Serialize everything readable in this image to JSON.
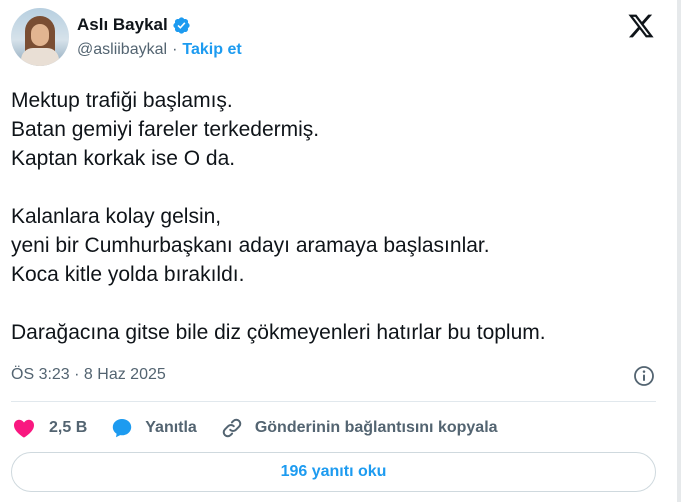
{
  "author": {
    "name": "Aslı Baykal",
    "handle": "@asliibaykal",
    "separator": "·",
    "follow_label": "Takip et"
  },
  "icons": {
    "verified": "verified-badge-icon",
    "platform": "x-logo-icon",
    "info": "info-icon",
    "like": "heart-icon",
    "reply": "reply-bubble-icon",
    "copy_link": "link-icon"
  },
  "colors": {
    "accent": "#1d9bf0",
    "like": "#f91880",
    "muted": "#536471",
    "text": "#0f1419"
  },
  "tweet": {
    "lines": [
      "Mektup trafiği başlamış.",
      "Batan gemiyi fareler terkedermiş.",
      "Kaptan korkak ise O da.",
      "",
      "Kalanlara kolay gelsin,",
      "yeni bir Cumhurbaşkanı adayı aramaya başlasınlar.",
      "Koca kitle yolda bırakıldı.",
      "",
      "Darağacına gitse bile diz çökmeyenleri hatırlar bu toplum."
    ],
    "timestamp": "ÖS 3:23 · 8 Haz 2025"
  },
  "actions": {
    "like_count": "2,5 B",
    "reply_label": "Yanıtla",
    "copy_link_label": "Gönderinin bağlantısını kopyala"
  },
  "replies_button": {
    "label": "196 yanıtı oku"
  }
}
